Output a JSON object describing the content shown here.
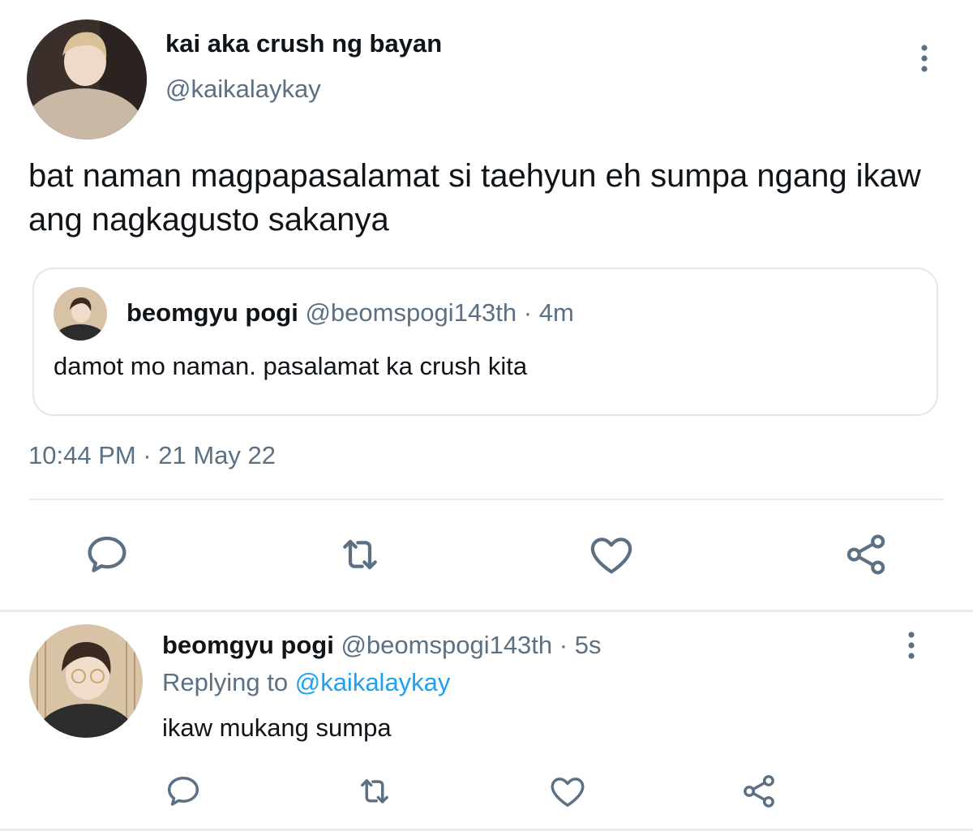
{
  "main_tweet": {
    "author_name": "kai aka crush ng bayan",
    "author_handle": "@kaikalaykay",
    "text": "bat naman magpapasalamat si taehyun eh sumpa ngang ikaw ang nagkagusto sakanya",
    "timestamp": "10:44 PM · 21 May 22",
    "avatar_icon": "avatar-photo",
    "more_icon": "more-vertical-icon"
  },
  "quoted_tweet": {
    "author_name": "beomgyu pogi",
    "author_handle": "@beomspogi143th",
    "time": " · 4m",
    "text": "damot mo naman. pasalamat ka crush kita",
    "avatar_icon": "avatar-photo"
  },
  "actions": [
    "reply-icon",
    "retweet-icon",
    "like-icon",
    "share-icon"
  ],
  "reply_tweet": {
    "author_name": "beomgyu pogi",
    "author_handle": "@beomspogi143th",
    "time": " · 5s",
    "replying_prefix": "Replying to ",
    "replying_mention": "@kaikalaykay",
    "text": "ikaw mukang sumpa",
    "avatar_icon": "avatar-photo",
    "more_icon": "more-vertical-icon"
  },
  "colors": {
    "text": "#0f1419",
    "secondary": "#5b7083",
    "link": "#1da1f2",
    "border": "#e1e8ed",
    "icon": "#5b7083"
  }
}
